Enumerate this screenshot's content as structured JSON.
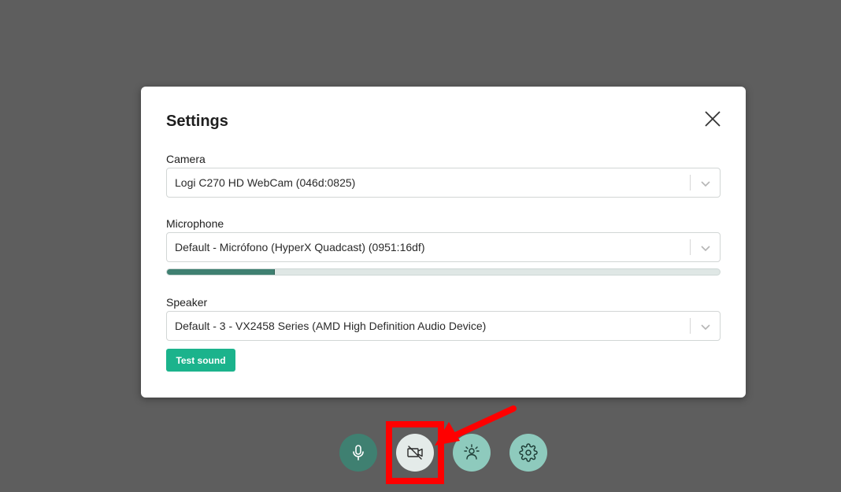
{
  "modal": {
    "title": "Settings",
    "close_icon": "close-icon"
  },
  "camera": {
    "label": "Camera",
    "selected": "Logi C270 HD WebCam (046d:0825)"
  },
  "microphone": {
    "label": "Microphone",
    "selected": "Default - Micrófono (HyperX Quadcast) (0951:16df)",
    "level_fraction": 0.195
  },
  "speaker": {
    "label": "Speaker",
    "selected": "Default - 3 - VX2458 Series (AMD High Definition Audio Device)",
    "test_button": "Test sound"
  },
  "controls": [
    {
      "name": "microphone",
      "icon": "microphone-icon"
    },
    {
      "name": "camera-off",
      "icon": "camera-off-icon"
    },
    {
      "name": "background-effects",
      "icon": "person-sparkle-icon"
    },
    {
      "name": "settings",
      "icon": "gear-icon"
    }
  ],
  "annotation": {
    "highlight_color": "#ff0000"
  },
  "colors": {
    "accent": "#1bb38c",
    "dark_teal": "#3f8071",
    "light_teal": "#8ecabd",
    "backdrop": "#5e5e5e"
  }
}
